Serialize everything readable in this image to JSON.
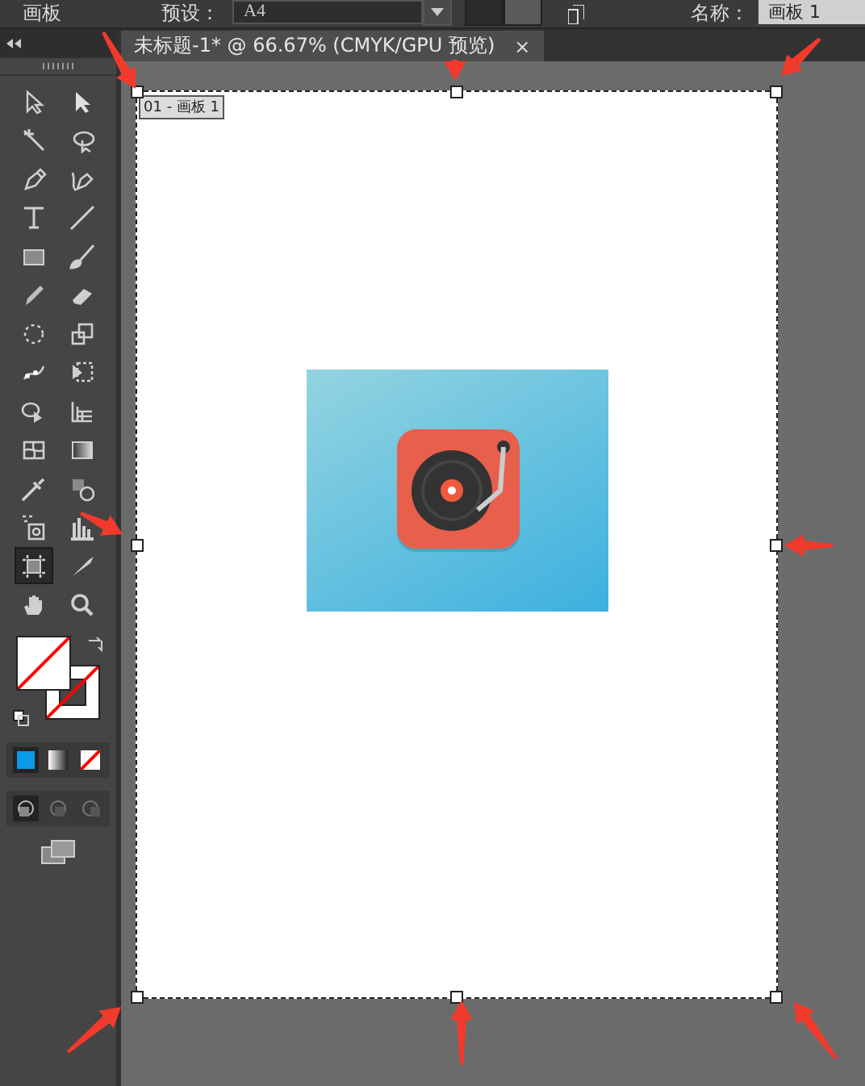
{
  "top_bar": {
    "panel_label": "画板",
    "preset_label": "预设：",
    "preset_value": "A4",
    "name_label": "名称：",
    "name_value": "画板 1"
  },
  "document_tab": {
    "title": "未标题-1* @ 66.67% (CMYK/GPU 预览)",
    "close": "×"
  },
  "tools": [
    {
      "selected": false
    },
    {
      "selected": false
    },
    {
      "selected": false
    },
    {
      "selected": false
    },
    {
      "selected": false
    },
    {
      "selected": false
    },
    {
      "selected": false
    },
    {
      "selected": false
    },
    {
      "selected": false
    },
    {
      "selected": false
    },
    {
      "selected": false
    },
    {
      "selected": false
    },
    {
      "selected": false
    },
    {
      "selected": false
    },
    {
      "selected": false
    },
    {
      "selected": false
    },
    {
      "selected": false
    },
    {
      "selected": false
    },
    {
      "selected": false
    },
    {
      "selected": false
    },
    {
      "selected": false
    },
    {
      "selected": false
    },
    {
      "selected": false
    },
    {
      "selected": false
    },
    {
      "selected": true
    },
    {
      "selected": false
    },
    {
      "selected": false
    },
    {
      "selected": false
    }
  ],
  "color_modes": [
    {
      "selected": true
    },
    {
      "selected": false
    },
    {
      "selected": false
    }
  ],
  "draw_modes": [
    {
      "selected": true
    },
    {
      "selected": false
    },
    {
      "selected": false
    }
  ],
  "artboard": {
    "label": "01 - 画板 1"
  }
}
